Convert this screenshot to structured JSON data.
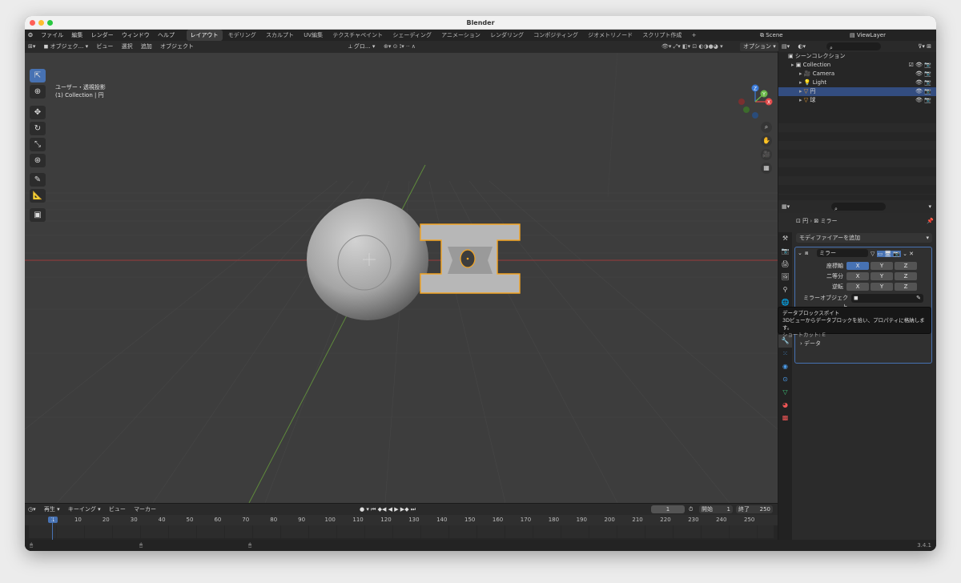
{
  "window": {
    "title": "Blender",
    "version": "3.4.1"
  },
  "colors": {
    "accent": "#4772b3",
    "selection_outline": "#f5a623",
    "x_axis": "#e24a4a",
    "y_axis": "#6bb84a",
    "z_axis": "#3a7ad8"
  },
  "menubar": {
    "items": [
      "ファイル",
      "編集",
      "レンダー",
      "ウィンドウ",
      "ヘルプ"
    ],
    "workspaces": [
      "レイアウト",
      "モデリング",
      "スカルプト",
      "UV編集",
      "テクスチャペイント",
      "シェーディング",
      "アニメーション",
      "レンダリング",
      "コンポジティング",
      "ジオメトリノード",
      "スクリプト作成"
    ],
    "active_workspace": "レイアウト",
    "plus": "+",
    "scene": "Scene",
    "viewlayer": "ViewLayer"
  },
  "viewport_header": {
    "mode": "オブジェク...",
    "menus": [
      "ビュー",
      "選択",
      "追加",
      "オブジェクト"
    ],
    "pivot": "グロ...",
    "options": "オプション"
  },
  "viewport": {
    "view_name": "ユーザー・透視投影",
    "collection_label": "(1) Collection | 円",
    "gizmo": {
      "x": "X",
      "y": "Y",
      "z": "Z"
    }
  },
  "outliner": {
    "root": "シーンコレクション",
    "items": [
      {
        "name": "Collection",
        "depth": 1
      },
      {
        "name": "Camera",
        "depth": 2
      },
      {
        "name": "Light",
        "depth": 2
      },
      {
        "name": "円",
        "depth": 2,
        "selected": true
      },
      {
        "name": "球",
        "depth": 2
      }
    ]
  },
  "properties": {
    "breadcrumb_object": "円",
    "breadcrumb_modifier": "ミラー",
    "add_modifier": "モディファイアーを追加",
    "modifier_name": "ミラー",
    "rows": [
      {
        "label": "座標軸",
        "x": "X",
        "y": "Y",
        "z": "Z"
      },
      {
        "label": "二等分",
        "x": "X",
        "y": "Y",
        "z": "Z"
      },
      {
        "label": "逆転",
        "x": "X",
        "y": "Y",
        "z": "Z"
      }
    ],
    "mirror_object_label": "ミラーオブジェクト",
    "data_section": "データ"
  },
  "tooltip": {
    "title": "データブロックスポイト",
    "description": "3Dビューからデータブロックを拾い、プロパティに格納します。",
    "shortcut": "ショートカット: E"
  },
  "timeline": {
    "menus": [
      "再生",
      "キーイング",
      "ビュー",
      "マーカー"
    ],
    "current_frame": "1",
    "start_label": "開始",
    "start": "1",
    "end_label": "終了",
    "end": "250",
    "ticks": [
      "1",
      "10",
      "20",
      "30",
      "40",
      "50",
      "60",
      "70",
      "80",
      "90",
      "100",
      "110",
      "120",
      "130",
      "140",
      "150",
      "160",
      "170",
      "180",
      "190",
      "200",
      "210",
      "220",
      "230",
      "240",
      "250"
    ]
  }
}
